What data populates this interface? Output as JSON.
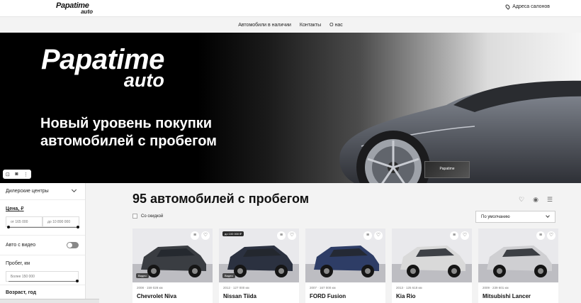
{
  "header": {
    "logo_line1": "Papatime",
    "logo_line2": "auto",
    "address_link": "Адреса салонов"
  },
  "nav": {
    "items": [
      "Автомобили в наличии",
      "Контакты",
      "О нас"
    ]
  },
  "hero": {
    "logo_line1": "Papatime",
    "logo_line2": "auto",
    "headline_line1": "Новый уровень покупки",
    "headline_line2": "автомобилей с пробегом",
    "thumb_text": "Papatime"
  },
  "filters": {
    "dealer_centers": "Дилерские центры",
    "price_label": "Цена,",
    "price_unit": "₽",
    "price_from_placeholder": "от 165 000",
    "price_to_placeholder": "до 10 890 000",
    "video_label": "Авто с видео",
    "mileage_label": "Пробег, км",
    "mileage_placeholder": "Более 150 000",
    "age_label": "Возраст, год"
  },
  "listing": {
    "title": "95 автомобилей с пробегом",
    "discount_label": "Со скидкой",
    "sort_label": "По умолчанию"
  },
  "cars": [
    {
      "name": "Chevrolet Niva",
      "meta": "2008 · 159 028 км",
      "badge": "Видео",
      "price_badge": "",
      "color": "#3a3d42"
    },
    {
      "name": "Nissan Tiida",
      "meta": "2012 · 127 000 км",
      "badge": "Видео",
      "price_badge": "до 100 000 ₽",
      "color": "#2b3140"
    },
    {
      "name": "FORD Fusion",
      "meta": "2007 · 167 000 км",
      "badge": "",
      "price_badge": "",
      "color": "#2e3d66"
    },
    {
      "name": "Kia Rio",
      "meta": "2013 · 125 618 км",
      "badge": "",
      "price_badge": "",
      "color": "#d9d9d9"
    },
    {
      "name": "Mitsubishi Lancer",
      "meta": "2009 · 239 601 км",
      "badge": "",
      "price_badge": "",
      "color": "#cfcfd2"
    }
  ]
}
